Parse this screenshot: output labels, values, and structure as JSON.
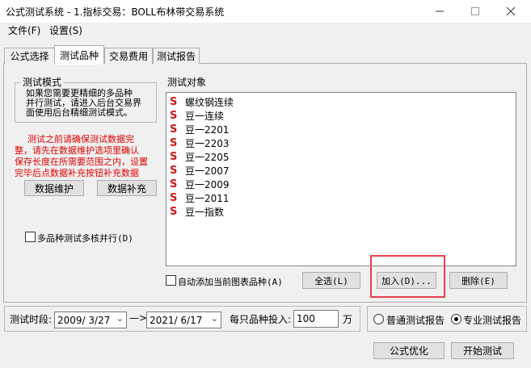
{
  "window": {
    "title": "公式测试系统 - 1.指标交易：BOLL布林带交易系统",
    "controls": [
      "minimize-icon",
      "maximize-icon",
      "close-icon"
    ]
  },
  "menu": {
    "file": "文件(F)",
    "settings": "设置(S)"
  },
  "tabs": [
    {
      "label": "公式选择",
      "active": false
    },
    {
      "label": "测试品种",
      "active": true
    },
    {
      "label": "交易费用",
      "active": false
    },
    {
      "label": "测试报告",
      "active": false
    }
  ],
  "test_mode": {
    "group_title": "测试模式",
    "desc_lines": [
      "如果您需要更精细的多品种",
      "并行测试，请进入后台交易界",
      "面使用后台精细测试模式。"
    ],
    "warning_lines": [
      "测试之前请确保测试数据完",
      "整，请先在数据维护选项里确认",
      "保存长度在所需要范围之内，设置",
      "完毕后点数据补充按钮补充数据"
    ],
    "btn_maintain": "数据维护",
    "btn_supplement": "数据补充",
    "multicore_label": "多品种测试多核并行(D)"
  },
  "test_objects": {
    "group_title": "测试对象",
    "items": [
      "螺纹钢连续",
      "豆一连续",
      "豆一2201",
      "豆一2203",
      "豆一2205",
      "豆一2007",
      "豆一2009",
      "豆一2011",
      "豆一指数"
    ],
    "auto_add_label": "自动添加当前图表品种(A)",
    "btn_select_all": "全选(L)",
    "btn_add": "加入(D)...",
    "btn_delete": "删除(E)"
  },
  "bottom": {
    "period_label": "测试时段:",
    "start_date": "2009/ 3/27",
    "arrow": "—>",
    "end_date": "2021/ 6/17",
    "invest_label": "每只品种投入:",
    "invest_value": "100",
    "invest_unit": "万",
    "radio_normal": "普通测试报告",
    "radio_pro": "专业测试报告",
    "btn_optimize": "公式优化",
    "btn_start": "开始测试"
  },
  "highlight_color": "#e8404a"
}
